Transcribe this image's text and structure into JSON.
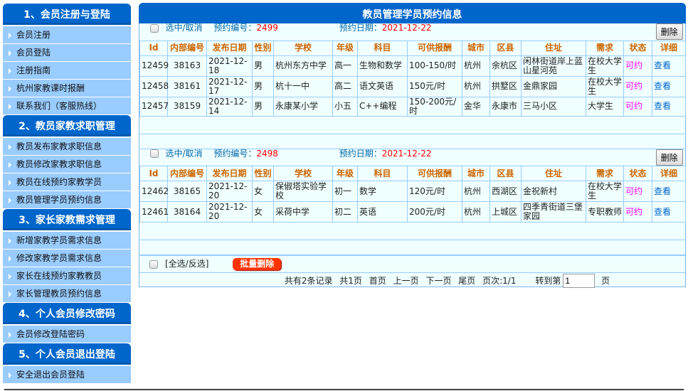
{
  "sidebar": {
    "sections": [
      {
        "title": "1、会员注册与登陆",
        "items": [
          "会员注册",
          "会员登陆",
          "注册指南",
          "杭州家教课时报酬",
          "联系我们（客服热线）"
        ]
      },
      {
        "title": "2、教员家教求职管理",
        "items": [
          "教员发布家教求职信息",
          "教员修改家教求职信息",
          "教员在线预约家教学员",
          "教员管理学员预约信息"
        ]
      },
      {
        "title": "3、家长家教需求管理",
        "items": [
          "新增家教学员需求信息",
          "修改家教学员需求信息",
          "家长在线预约家教教员",
          "家长管理教员预约信息"
        ]
      },
      {
        "title": "4、个人会员修改密码",
        "items": [
          "会员修改登陆密码"
        ]
      },
      {
        "title": "5、个人会员退出登陆",
        "items": [
          "安全退出会员登陆"
        ]
      }
    ]
  },
  "main": {
    "title": "教员管理学员预约信息",
    "select_label": "选中/取消",
    "booking_no_label": "预约编号：",
    "booking_date_label": "预约日期：",
    "delete_label": "删除",
    "columns": [
      "Id",
      "内部编号",
      "发布日期",
      "性别",
      "学校",
      "年级",
      "科目",
      "可供报酬",
      "城市",
      "区县",
      "住址",
      "需求",
      "状态",
      "详细"
    ],
    "groups": [
      {
        "booking_no": "2499",
        "booking_date": "2021-12-22",
        "rows": [
          [
            "12459",
            "38163",
            "2021-12-18",
            "男",
            "杭州东方中学",
            "高一",
            "生物和数学",
            "100-150/时",
            "杭州",
            "余杭区",
            "闲林街道岸上蓝山星河苑",
            "在校大学生",
            "可约",
            "查看"
          ],
          [
            "12458",
            "38161",
            "2021-12-17",
            "男",
            "杭十一中",
            "高二",
            "语文英语",
            "150元/时",
            "杭州",
            "拱墅区",
            "金鼎家园",
            "在校大学生",
            "可约",
            "查看"
          ],
          [
            "12457",
            "38159",
            "2021-12-14",
            "男",
            "永康某小学",
            "小五",
            "C++编程",
            "150-200元/时",
            "金华",
            "永康市",
            "三马小区",
            "大学生",
            "可约",
            "查看"
          ]
        ]
      },
      {
        "booking_no": "2498",
        "booking_date": "2021-12-22",
        "rows": [
          [
            "12462",
            "38165",
            "2021-12-20",
            "女",
            "保俶塔实验学校",
            "初一",
            "数学",
            "120元/时",
            "杭州",
            "西湖区",
            "金祝新村",
            "在校大学生",
            "可约",
            "查看"
          ],
          [
            "12461",
            "38164",
            "2021-12-20",
            "女",
            "采荷中学",
            "初二",
            "英语",
            "200元/时",
            "杭州",
            "上城区",
            "四季青街道三堡家园",
            "专职教师",
            "可约",
            "查看"
          ]
        ]
      }
    ],
    "select_all_label": "[全选/反选]",
    "batch_delete_label": "批量删除",
    "pagination": {
      "total": "共有2条记录",
      "pages": "共1页",
      "first": "首页",
      "prev": "上一页",
      "next": "下一页",
      "last": "尾页",
      "page_info": "页次:1/1",
      "goto_label": "转到第",
      "goto_value": "1",
      "page_suffix": "页"
    }
  },
  "colors": {
    "header_blue": "#0066cc",
    "menu_blue": "#99ccff",
    "column_header": "#cc6600",
    "status": "#ff00ff",
    "link": "#0066cc",
    "batch_button": "#ff3300"
  }
}
